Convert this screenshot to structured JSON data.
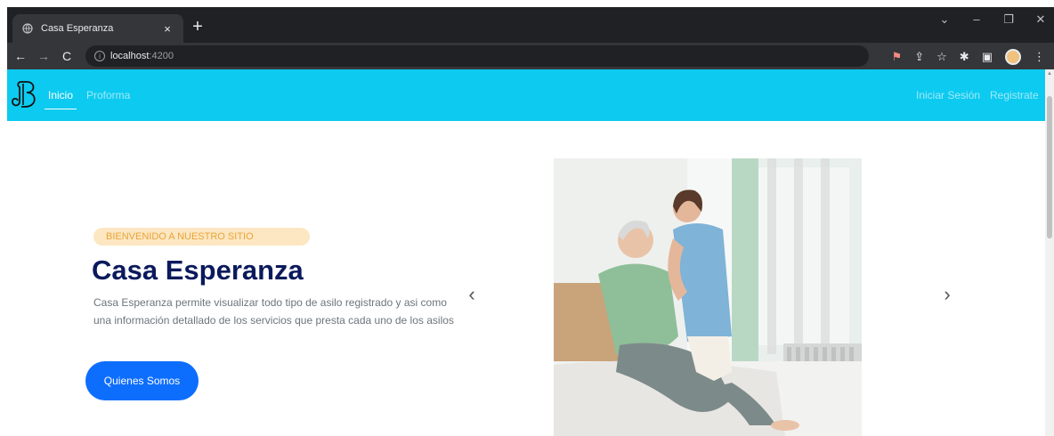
{
  "browser": {
    "tab_title": "Casa Esperanza",
    "tab_close": "×",
    "new_tab": "+",
    "url_host": "localhost",
    "url_port": ":4200",
    "win_controls": [
      "⌄",
      "–",
      "❐",
      "✕"
    ]
  },
  "nav": {
    "logo_text": "JB",
    "links": [
      "Inicio",
      "Proforma"
    ],
    "right_links": [
      "Iniciar Sesión",
      "Registrate"
    ],
    "accent": "#0dcaf0"
  },
  "hero": {
    "badge": "BIENVENIDO A NUESTRO SITIO",
    "title": "Casa Esperanza",
    "description": "Casa Esperanza permite visualizar todo tipo de asilo registrado y asi como una información detallado de los servicios que presta cada uno de los asilos",
    "cta": "Quienes Somos",
    "cta_color": "#0d6efd"
  },
  "carousel": {
    "prev": "‹",
    "next": "›"
  }
}
